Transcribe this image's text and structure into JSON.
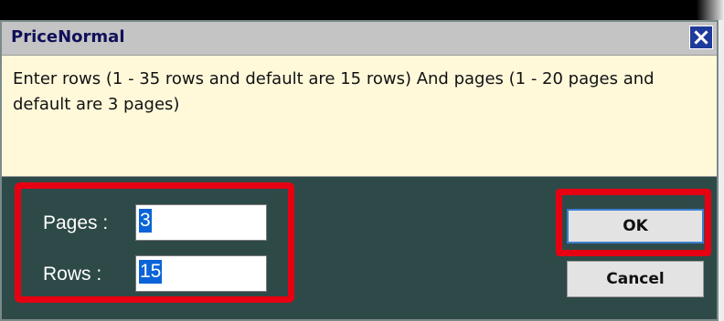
{
  "dialog": {
    "title": "PriceNormal",
    "close_icon": "close-icon",
    "message": "Enter rows (1 - 35 rows and default are 15 rows) And pages (1 - 20 pages and default are 3 pages)"
  },
  "form": {
    "pages_label": "Pages :",
    "pages_value": "3",
    "rows_label": "Rows :",
    "rows_value": "15"
  },
  "buttons": {
    "ok_label": "OK",
    "cancel_label": "Cancel"
  },
  "colors": {
    "dialog_background": "#2e4a48",
    "message_background": "#fff9da",
    "highlight_red": "#e60012",
    "title_text": "#10105a",
    "selection_blue": "#0a64d8"
  }
}
